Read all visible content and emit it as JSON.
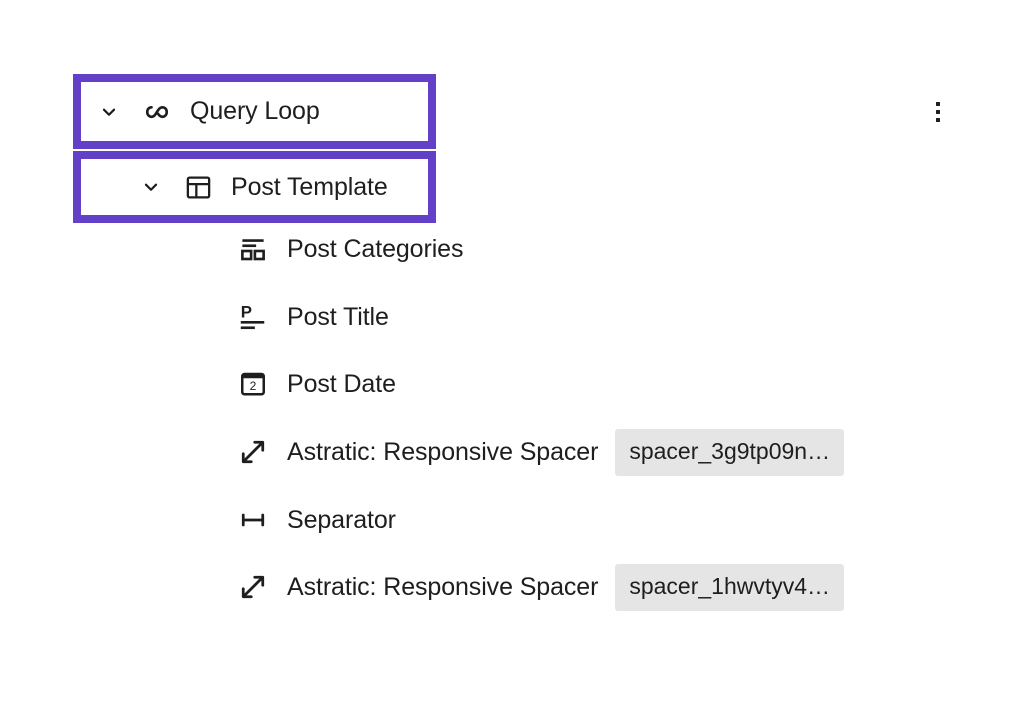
{
  "panel": {
    "name": "list-view",
    "accent_color": "#6240c8",
    "badge_bg_color": "#e5e5e5",
    "text_color": "#1e1e1e",
    "background_color": "#ffffff"
  },
  "options_menu": {
    "label": "Options",
    "icon": "kebab-menu-icon"
  },
  "selected_blocks": [
    {
      "label": "Query Loop",
      "icon": "loop-icon",
      "chevron": "chevron-down-icon",
      "expanded": true,
      "depth": 0,
      "selected": true
    },
    {
      "label": "Post Template",
      "icon": "post-template-icon",
      "chevron": "chevron-down-icon",
      "expanded": true,
      "depth": 1,
      "selected": true
    }
  ],
  "child_blocks": [
    {
      "label": "Post Categories",
      "icon": "post-categories-icon",
      "badge": ""
    },
    {
      "label": "Post Title",
      "icon": "post-title-icon",
      "badge": ""
    },
    {
      "label": "Post Date",
      "icon": "post-date-icon",
      "badge": ""
    },
    {
      "label": "Astratic: Responsive Spacer",
      "icon": "responsive-spacer-icon",
      "badge": "spacer_3g9tp09n…"
    },
    {
      "label": "Separator",
      "icon": "separator-icon",
      "badge": ""
    },
    {
      "label": "Astratic: Responsive Spacer",
      "icon": "responsive-spacer-icon",
      "badge": "spacer_1hwvtyv4…"
    }
  ]
}
